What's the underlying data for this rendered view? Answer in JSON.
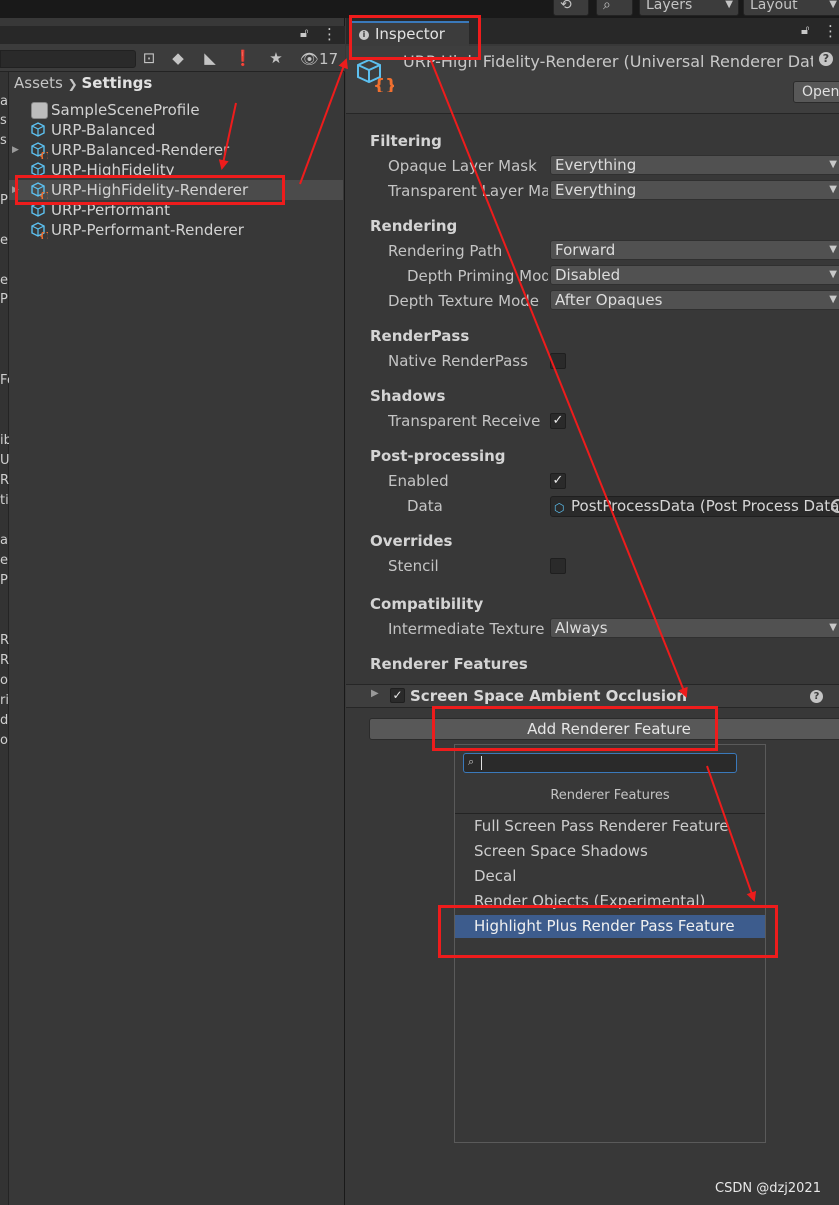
{
  "toolbar": {
    "layers_label": "Layers",
    "layout_label": "Layout"
  },
  "project": {
    "badge_count": "17",
    "breadcrumb": {
      "root": "Assets",
      "current": "Settings"
    },
    "assets": [
      {
        "label": "SampleSceneProfile",
        "icon": "volume-profile-icon"
      },
      {
        "label": "URP-Balanced",
        "icon": "urp-asset-icon"
      },
      {
        "label": "URP-Balanced-Renderer",
        "icon": "urp-renderer-icon"
      },
      {
        "label": "URP-HighFidelity",
        "icon": "urp-asset-icon"
      },
      {
        "label": "URP-HighFidelity-Renderer",
        "icon": "urp-renderer-icon"
      },
      {
        "label": "URP-Performant",
        "icon": "urp-asset-icon"
      },
      {
        "label": "URP-Performant-Renderer",
        "icon": "urp-renderer-icon"
      }
    ],
    "tree_clipped": [
      "al",
      "s",
      "s",
      "Pl",
      "e",
      "e",
      "Pl",
      "Fo",
      "ib",
      "U",
      "R",
      "ti",
      "a",
      "e",
      "P",
      "R",
      "R",
      "o",
      "ri",
      "d",
      "o"
    ]
  },
  "inspector": {
    "tab_label": "Inspector",
    "title": "URP-High Fidelity-Renderer (Universal Renderer Data)",
    "open_label": "Open",
    "sections": {
      "filtering": "Filtering",
      "rendering": "Rendering",
      "renderpass": "RenderPass",
      "shadows": "Shadows",
      "postprocessing": "Post-processing",
      "overrides": "Overrides",
      "compatibility": "Compatibility",
      "renderer_features": "Renderer Features"
    },
    "props": {
      "opaque_layer_mask": {
        "label": "Opaque Layer Mask",
        "value": "Everything"
      },
      "transparent_layer_mask": {
        "label": "Transparent Layer Mask",
        "value": "Everything"
      },
      "rendering_path": {
        "label": "Rendering Path",
        "value": "Forward"
      },
      "depth_priming_mode": {
        "label": "Depth Priming Mode",
        "value": "Disabled"
      },
      "depth_texture_mode": {
        "label": "Depth Texture Mode",
        "value": "After Opaques"
      },
      "native_renderpass": {
        "label": "Native RenderPass",
        "checked": false
      },
      "transparent_receive_shadows": {
        "label": "Transparent Receive Shadows",
        "checked": true
      },
      "pp_enabled": {
        "label": "Enabled",
        "checked": true
      },
      "pp_data": {
        "label": "Data",
        "value": "PostProcessData (Post Process Data)"
      },
      "stencil": {
        "label": "Stencil",
        "checked": false
      },
      "intermediate_texture": {
        "label": "Intermediate Texture",
        "value": "Always"
      }
    },
    "feature": {
      "label": "Screen Space Ambient Occlusion",
      "enabled": true
    },
    "add_feature_label": "Add Renderer Feature"
  },
  "popup": {
    "search_value": "",
    "header": "Renderer Features",
    "items": [
      "Full Screen Pass Renderer Feature",
      "Screen Space Shadows",
      "Decal",
      "Render Objects (Experimental)",
      "Highlight Plus Render Pass Feature"
    ],
    "highlighted_index": 4
  },
  "watermark": "CSDN @dzj2021",
  "colors": {
    "annotation": "#ee1c1c",
    "selection": "#3d5c8d",
    "accent": "#3a79bb"
  }
}
